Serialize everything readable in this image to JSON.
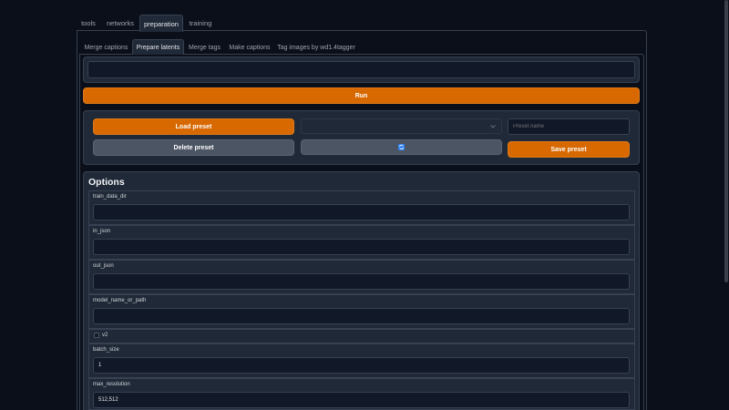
{
  "top_tabs": [
    "tools",
    "networks",
    "preparation",
    "training"
  ],
  "sub_tabs": [
    "Merge captions",
    "Prepare latents",
    "Merge tags",
    "Make captions",
    "Tag images by wd1.4tagger"
  ],
  "run_label": "Run",
  "preset": {
    "load_label": "Load preset",
    "delete_label": "Delete preset",
    "save_label": "Save preset",
    "name_placeholder": "Preset name",
    "selected": ""
  },
  "options": {
    "title": "Options",
    "fields": {
      "train_data_dir": {
        "label": "train_data_dir",
        "value": ""
      },
      "in_json": {
        "label": "in_json",
        "value": ""
      },
      "out_json": {
        "label": "out_json",
        "value": ""
      },
      "model_name_or_path": {
        "label": "model_name_or_path",
        "value": ""
      },
      "v2": {
        "label": "v2",
        "checked": false
      },
      "batch_size": {
        "label": "batch_size",
        "value": "1"
      },
      "max_resolution": {
        "label": "max_resolution",
        "value": "512,512"
      }
    }
  },
  "colors": {
    "accent": "#d86800",
    "background": "#0b0f19",
    "panel": "#1f2937"
  }
}
